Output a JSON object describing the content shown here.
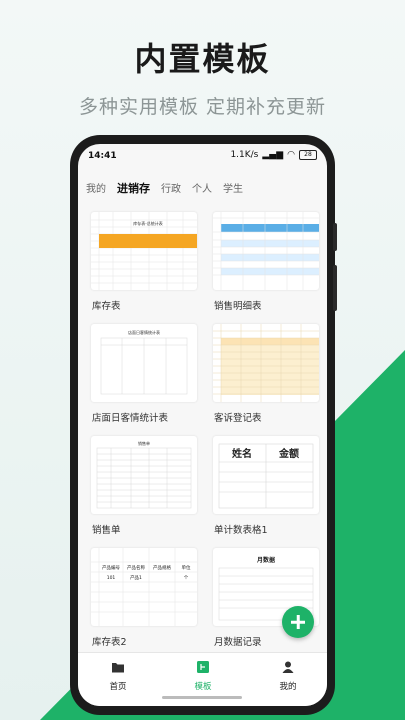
{
  "hero": {
    "title": "内置模板",
    "subtitle": "多种实用模板 定期补充更新"
  },
  "colors": {
    "accent": "#1eb268",
    "orange": "#f5a623",
    "blue": "#5aaee6",
    "cream": "#fcefd0"
  },
  "status_bar": {
    "time": "14:41",
    "net_speed": "1.1K/s",
    "battery": "28"
  },
  "tabs": [
    {
      "label": "我的"
    },
    {
      "label": "进销存"
    },
    {
      "label": "行政"
    },
    {
      "label": "个人"
    },
    {
      "label": "学生"
    }
  ],
  "templates": [
    {
      "label": "库存表",
      "thumb_title": "库存表-总统计表"
    },
    {
      "label": "销售明细表"
    },
    {
      "label": "店面日客情统计表",
      "thumb_title": "店面日客情统计表"
    },
    {
      "label": "客诉登记表"
    },
    {
      "label": "销售单",
      "thumb_title": "销售单"
    },
    {
      "label": "单计数表格1",
      "thumb_headers": [
        "姓名",
        "金额"
      ]
    },
    {
      "label": "库存表2",
      "thumb_headers": [
        "产品编号",
        "产品名称",
        "产品规格",
        "单位"
      ],
      "thumb_row": [
        "101",
        "产品1",
        "",
        "个"
      ]
    },
    {
      "label": "月数据记录",
      "thumb_title": "月数据"
    }
  ],
  "bottom_nav": [
    {
      "label": "首页",
      "icon": "folder-icon"
    },
    {
      "label": "模板",
      "icon": "template-icon"
    },
    {
      "label": "我的",
      "icon": "person-icon"
    }
  ]
}
